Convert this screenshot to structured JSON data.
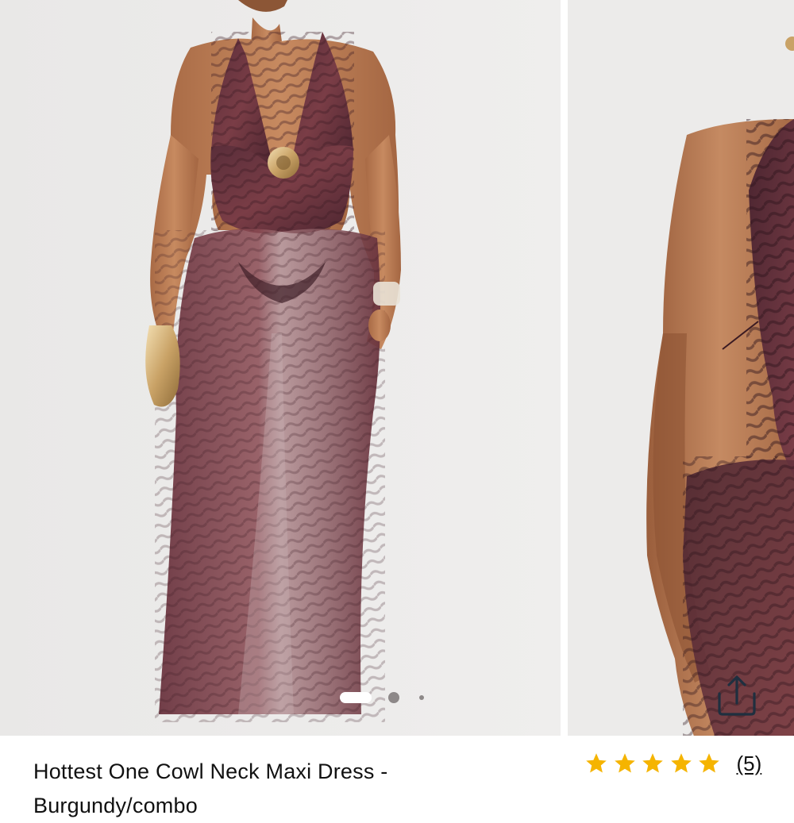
{
  "product": {
    "title_line1": "Hottest One Cowl Neck Maxi Dress -",
    "title_line2": "Burgundy/combo"
  },
  "gallery": {
    "image_count": 3,
    "active_index": 1,
    "share_icon": "share-icon"
  },
  "rating": {
    "stars": 5,
    "review_count": "(5)",
    "star_color": "#f5b400"
  }
}
